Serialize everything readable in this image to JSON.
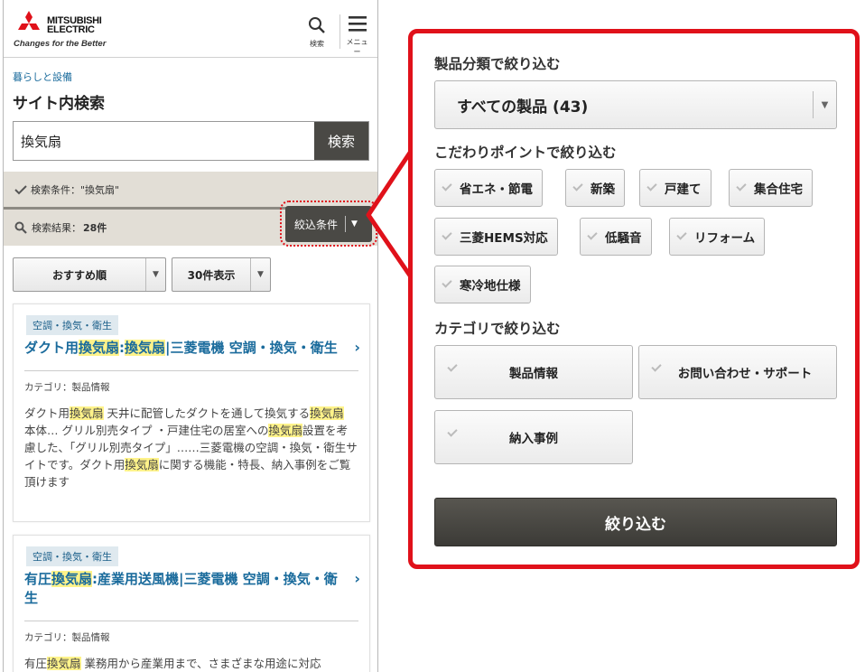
{
  "colors": {
    "accent_red": "#e0111a",
    "link_blue": "#1a6b9c",
    "dark_button": "#4a4945",
    "condition_bg": "#e2ded6",
    "highlight": "#fff38a"
  },
  "header": {
    "brand_line1": "MITSUBISHI",
    "brand_line2": "ELECTRIC",
    "tagline": "Changes for the Better",
    "search_label": "検索",
    "menu_label": "メニュー",
    "search_icon": "search-icon",
    "menu_icon": "hamburger-icon"
  },
  "breadcrumb": "暮らしと設備",
  "page_title": "サイト内検索",
  "search": {
    "value": "換気扇",
    "button": "検索"
  },
  "condition": {
    "text": "検索条件：\"換気扇\""
  },
  "results": {
    "label": "検索結果：",
    "count": "28件",
    "filter_button": "絞込条件"
  },
  "sort": {
    "order": "おすすめ順",
    "per_page": "30件表示"
  },
  "cards": [
    {
      "tag": "空調・換気・衛生",
      "title_parts": [
        "ダクト用",
        "換気扇",
        ":",
        "換気扇",
        "|三菱電機 空調・換気・衛生"
      ],
      "category": "カテゴリ：製品情報",
      "snippet_parts": [
        "ダクト用",
        "換気扇",
        " 天井に配管したダクトを通して換気する",
        "換気扇",
        " 本体… グリル別売タイプ ・戸建住宅の居室への",
        "換気扇",
        "設置を考慮した、「グリル別売タイプ」……三菱電機の空調・換気・衛生サイトです。ダクト用",
        "換気扇",
        "に関する機能・特長、納入事例をご覧頂けます"
      ]
    },
    {
      "tag": "空調・換気・衛生",
      "title_parts": [
        "有圧",
        "換気扇",
        ":産業用送風機|三菱電機 空調・換気・衛生"
      ],
      "category": "カテゴリ：製品情報",
      "snippet_parts": [
        "有圧",
        "換気扇",
        " 業務用から産業用まで、さまざまな用途に対応"
      ]
    }
  ],
  "panel": {
    "product_heading": "製品分類で絞り込む",
    "product_select": "すべての製品 (43)",
    "point_heading": "こだわりポイントで絞り込む",
    "points": [
      "省エネ・節電",
      "新築",
      "戸建て",
      "集合住宅",
      "三菱HEMS対応",
      "低騒音",
      "リフォーム",
      "寒冷地仕様"
    ],
    "category_heading": "カテゴリで絞り込む",
    "categories": [
      "製品情報",
      "お問い合わせ・サポート",
      "納入事例"
    ],
    "submit": "絞り込む"
  }
}
